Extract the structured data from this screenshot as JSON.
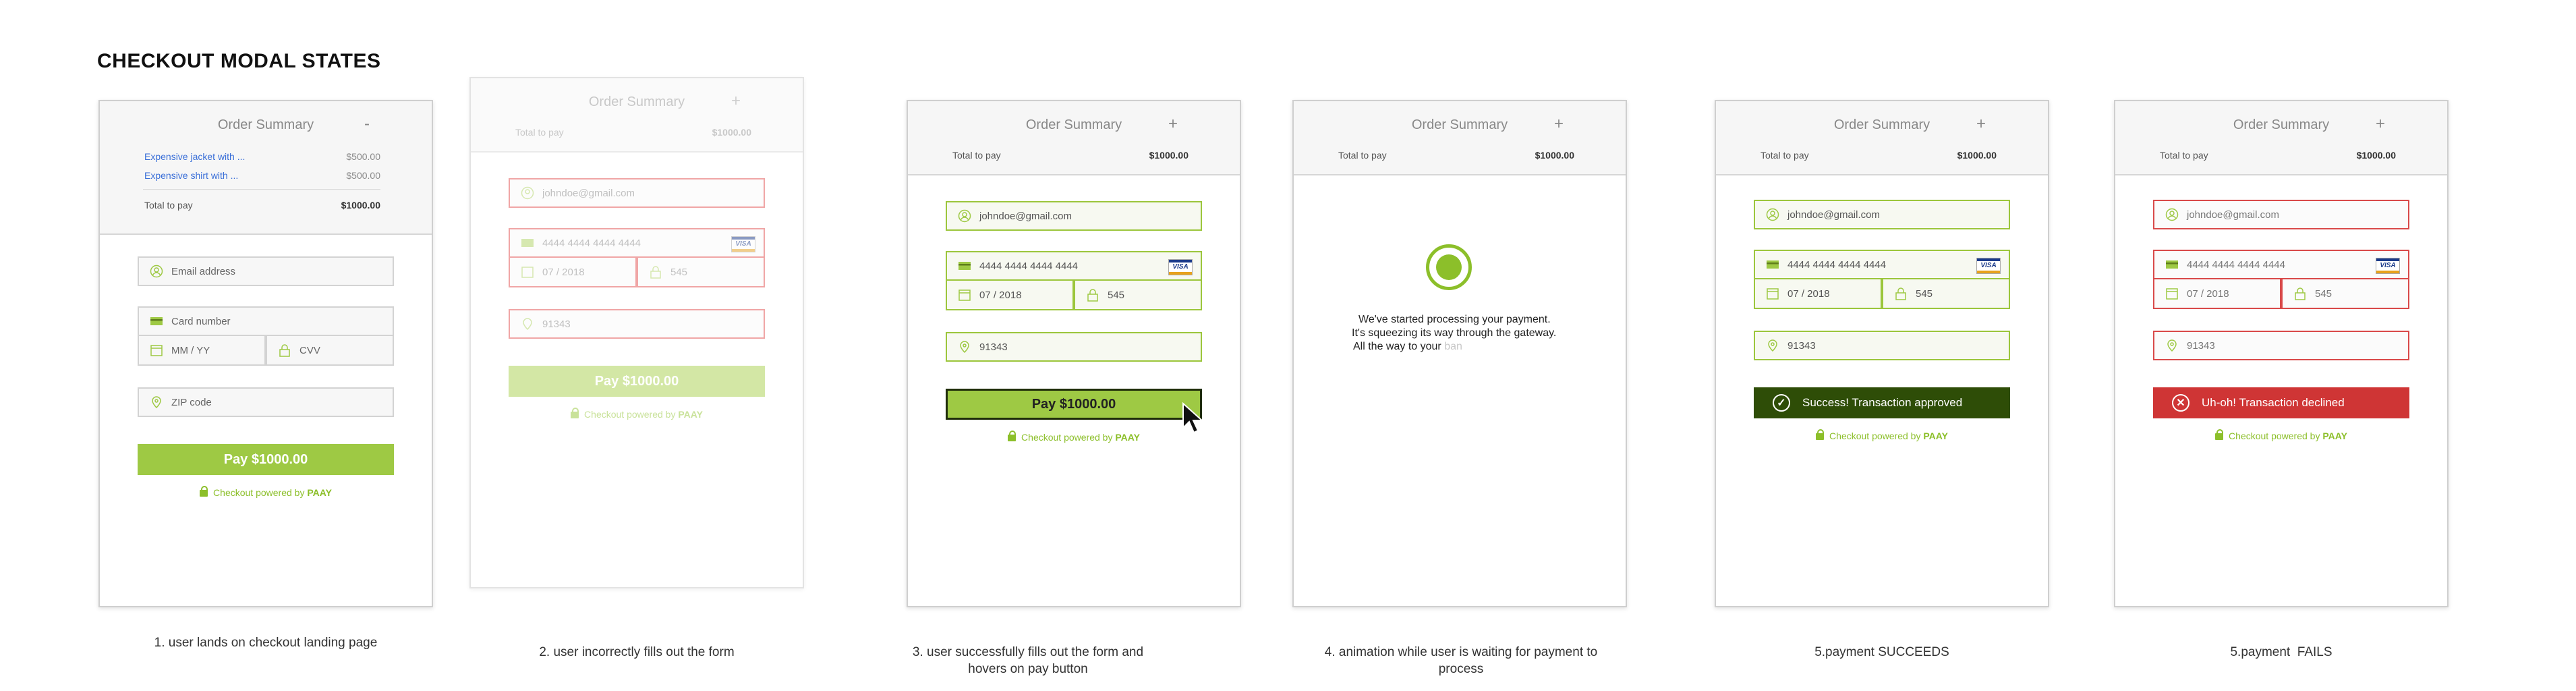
{
  "title": "CHECKOUT MODAL STATES",
  "summary": {
    "title": "Order Summary",
    "collapse_symbol": "-",
    "expand_symbol": "+",
    "items": [
      {
        "name": "Expensive jacket with ...",
        "price": "$500.00"
      },
      {
        "name": "Expensive shirt with ...",
        "price": "$500.00"
      }
    ],
    "total_label": "Total to pay",
    "total_amount": "$1000.00"
  },
  "form": {
    "email_placeholder": "Email address",
    "card_placeholder": "Card number",
    "expiry_placeholder": "MM / YY",
    "cvv_placeholder": "CVV",
    "zip_placeholder": "ZIP code",
    "email_value": "johndoe@gmail.com",
    "card_value": "4444 4444 4444 4444",
    "expiry_value": "07 / 2018",
    "cvv_value": "545",
    "zip_value": "91343",
    "card_brand": "VISA"
  },
  "pay_label": "Pay $1000.00",
  "powered": {
    "text": "Checkout powered by",
    "brand": "PAAY"
  },
  "animation": {
    "line1": "We've started processing your payment.",
    "line2": "It's squeezing its way through the gateway.",
    "line3_visible": "All the way to your",
    "line3_faded": "ban"
  },
  "success_text": "Success! Transaction approved",
  "fail_text": "Uh-oh! Transaction declined",
  "captions": [
    "1. user lands on checkout landing page",
    "2. user incorrectly fills out the form",
    "3. user successfully fills out the form and hovers on pay button",
    "4. animation while user is waiting for payment to process",
    "5.payment SUCCEEDS",
    "5.payment  FAILS"
  ],
  "colors": {
    "accent": "#9ec944",
    "error": "#cf3535",
    "success": "#2e4d07",
    "link": "#3a6fd8"
  }
}
